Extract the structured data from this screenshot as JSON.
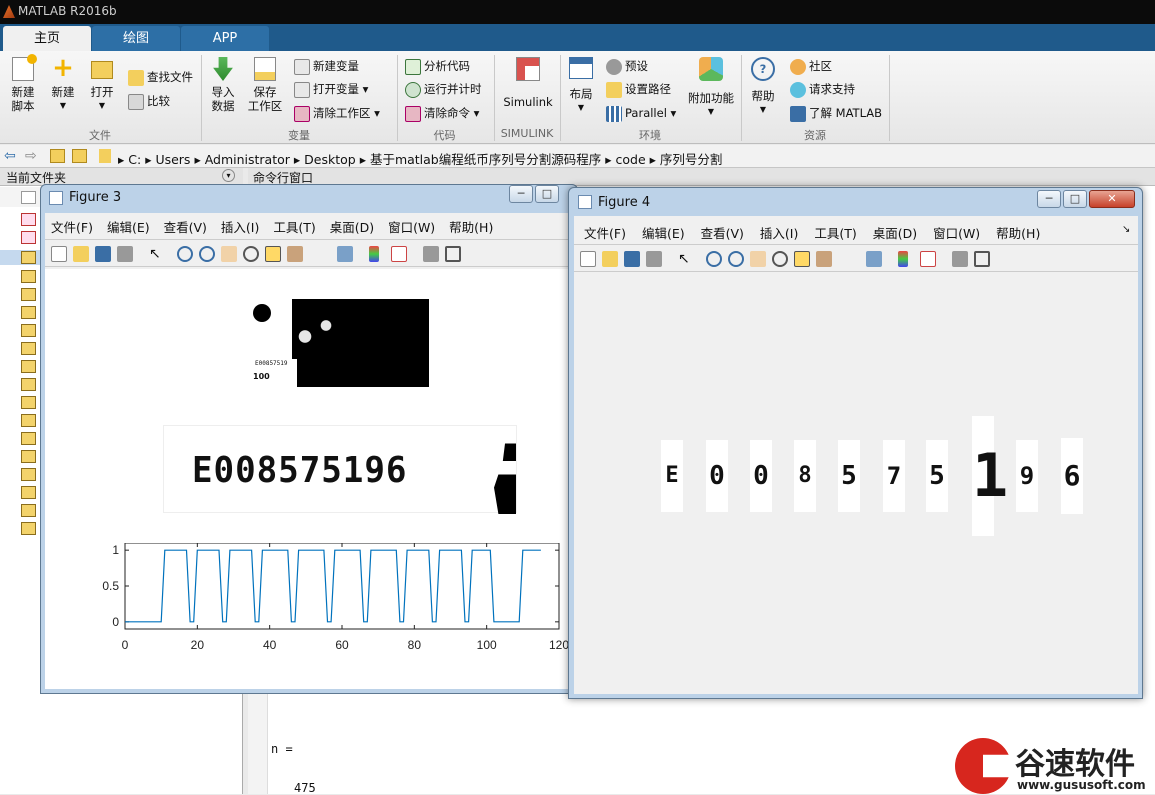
{
  "app": {
    "title": "MATLAB R2016b"
  },
  "tabs": [
    {
      "label": "主页"
    },
    {
      "label": "绘图"
    },
    {
      "label": "APP"
    }
  ],
  "ribbon": {
    "file": {
      "group": "文件",
      "new_script": "新建\n脚本",
      "new": "新建",
      "open": "打开",
      "find_files": "查找文件",
      "compare": "比较"
    },
    "variable": {
      "group": "变量",
      "import": "导入\n数据",
      "save_ws": "保存\n工作区",
      "new_var": "新建变量",
      "open_var": "打开变量",
      "clear_ws": "清除工作区"
    },
    "code": {
      "group": "代码",
      "analyze": "分析代码",
      "run_time": "运行并计时",
      "clear_cmd": "清除命令"
    },
    "simulink": {
      "group": "SIMULINK",
      "simulink": "Simulink"
    },
    "env": {
      "group": "环境",
      "layout": "布局",
      "prefs": "预设",
      "set_path": "设置路径",
      "parallel": "Parallel",
      "addons": "附加功能"
    },
    "resources": {
      "group": "资源",
      "help": "帮助",
      "community": "社区",
      "support": "请求支持",
      "learn": "了解 MATLAB"
    }
  },
  "address": {
    "path": [
      "C:",
      "Users",
      "Administrator",
      "Desktop",
      "基于matlab编程纸币序列号分割源码程序",
      "code",
      "序列号分割"
    ]
  },
  "panels": {
    "current_folder": "当前文件夹",
    "command_window": "命令行窗口"
  },
  "command": {
    "line1": "n =",
    "line2": "475"
  },
  "figure3": {
    "title": "Figure 3",
    "menu": [
      "文件(F)",
      "编辑(E)",
      "查看(V)",
      "插入(I)",
      "工具(T)",
      "桌面(D)",
      "窗口(W)",
      "帮助(H)"
    ],
    "serial_text": "E008575196",
    "note_small_text": "E00857519",
    "note_denom": "100"
  },
  "figure4": {
    "title": "Figure 4",
    "menu": [
      "文件(F)",
      "编辑(E)",
      "查看(V)",
      "插入(I)",
      "工具(T)",
      "桌面(D)",
      "窗口(W)",
      "帮助(H)"
    ],
    "digits": [
      "E",
      "0",
      "0",
      "8",
      "5",
      "7",
      "5",
      "1",
      "9",
      "6"
    ]
  },
  "chart_data": {
    "type": "line",
    "title": "",
    "xlabel": "",
    "ylabel": "",
    "xlim": [
      0,
      120
    ],
    "ylim": [
      -0.1,
      1.1
    ],
    "xticks": [
      "0",
      "20",
      "40",
      "60",
      "80",
      "100",
      "120"
    ],
    "yticks": [
      "0",
      "0.5",
      "1"
    ],
    "grid": false,
    "color": "#0072bd",
    "x": [
      0,
      10,
      11,
      17,
      18,
      19,
      20,
      26,
      27,
      28,
      29,
      35,
      36,
      37,
      38,
      45,
      46,
      47,
      48,
      55,
      56,
      57,
      58,
      65,
      66,
      67,
      68,
      75,
      76,
      77,
      78,
      84,
      85,
      86,
      87,
      93,
      94,
      95,
      96,
      101,
      102,
      108,
      109,
      110,
      115
    ],
    "y": [
      0,
      0,
      1,
      1,
      0,
      0,
      1,
      1,
      0,
      0,
      1,
      1,
      0,
      0,
      1,
      1,
      0,
      0,
      1,
      1,
      0,
      0,
      1,
      1,
      0,
      0,
      1,
      1,
      0,
      0,
      1,
      1,
      0,
      0,
      1,
      1,
      0,
      0,
      1,
      1,
      0,
      0,
      0,
      1,
      1
    ]
  },
  "watermark": {
    "brand": "谷速软件",
    "url": "www.gususoft.com"
  }
}
